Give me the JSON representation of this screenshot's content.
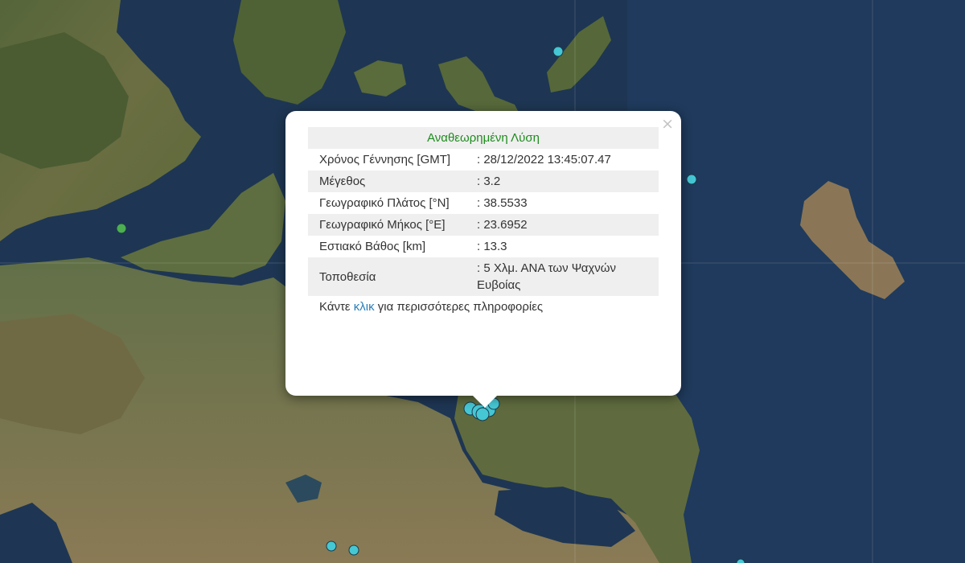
{
  "popup": {
    "title": "Αναθεωρημένη Λύση",
    "close_glyph": "×",
    "rows": [
      {
        "label": "Χρόνος Γέννησης [GMT]",
        "value": ": 28/12/2022 13:45:07.47"
      },
      {
        "label": "Μέγεθος",
        "value": ": 3.2"
      },
      {
        "label": "Γεωγραφικό Πλάτος [°N]",
        "value": ": 38.5533"
      },
      {
        "label": "Γεωγραφικό Μήκος [°E]",
        "value": ": 23.6952"
      },
      {
        "label": "Εστιακό Βάθος [km]",
        "value": ": 13.3"
      },
      {
        "label": "Τοποθεσία",
        "value": ": 5 Χλμ. ΑΝΑ των Ψαχνών Ευβοίας"
      }
    ],
    "more_before": "Κάντε ",
    "more_link": "κλικ",
    "more_after": " για περισσότερες πληροφορίες"
  },
  "colors": {
    "sea": "#1d3550",
    "land": "#5a6a3c",
    "marker_cyan": "#45c7d4",
    "marker_green": "#4caf50",
    "title_green": "#1e8c1e",
    "link": "#2a7fb8"
  }
}
